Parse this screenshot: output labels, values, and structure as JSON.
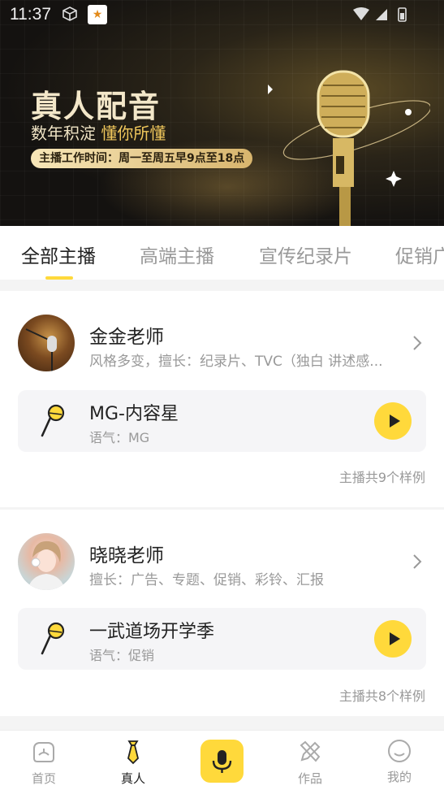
{
  "status_bar": {
    "time": "11:37"
  },
  "banner": {
    "title": "真人配音",
    "subtitle_plain": "数年积淀",
    "subtitle_highlight": "懂你所懂",
    "hours": "主播工作时间：周一至周五早9点至18点"
  },
  "tabs": [
    {
      "label": "全部主播",
      "active": true
    },
    {
      "label": "高端主播",
      "active": false
    },
    {
      "label": "宣传纪录片",
      "active": false
    },
    {
      "label": "促销广",
      "active": false
    }
  ],
  "anchors": [
    {
      "name": "金金老师",
      "description": "风格多变，擅长：纪录片、TVC（独白 讲述感...",
      "sample": {
        "title": "MG-内容星",
        "tone": "语气：MG"
      },
      "sample_count": "主播共9个样例"
    },
    {
      "name": "晓晓老师",
      "description": "擅长：广告、专题、促销、彩铃、汇报",
      "sample": {
        "title": "一武道场开学季",
        "tone": "语气：促销"
      },
      "sample_count": "主播共8个样例"
    }
  ],
  "bottom_nav": [
    {
      "label": "首页",
      "icon": "home-icon"
    },
    {
      "label": "真人",
      "icon": "tie-icon",
      "active": true
    },
    {
      "label": "",
      "icon": "microphone-icon"
    },
    {
      "label": "作品",
      "icon": "pencil-icon"
    },
    {
      "label": "我的",
      "icon": "smile-icon"
    }
  ],
  "colors": {
    "accent": "#ffd93b",
    "text": "#222222",
    "muted": "#999999"
  }
}
